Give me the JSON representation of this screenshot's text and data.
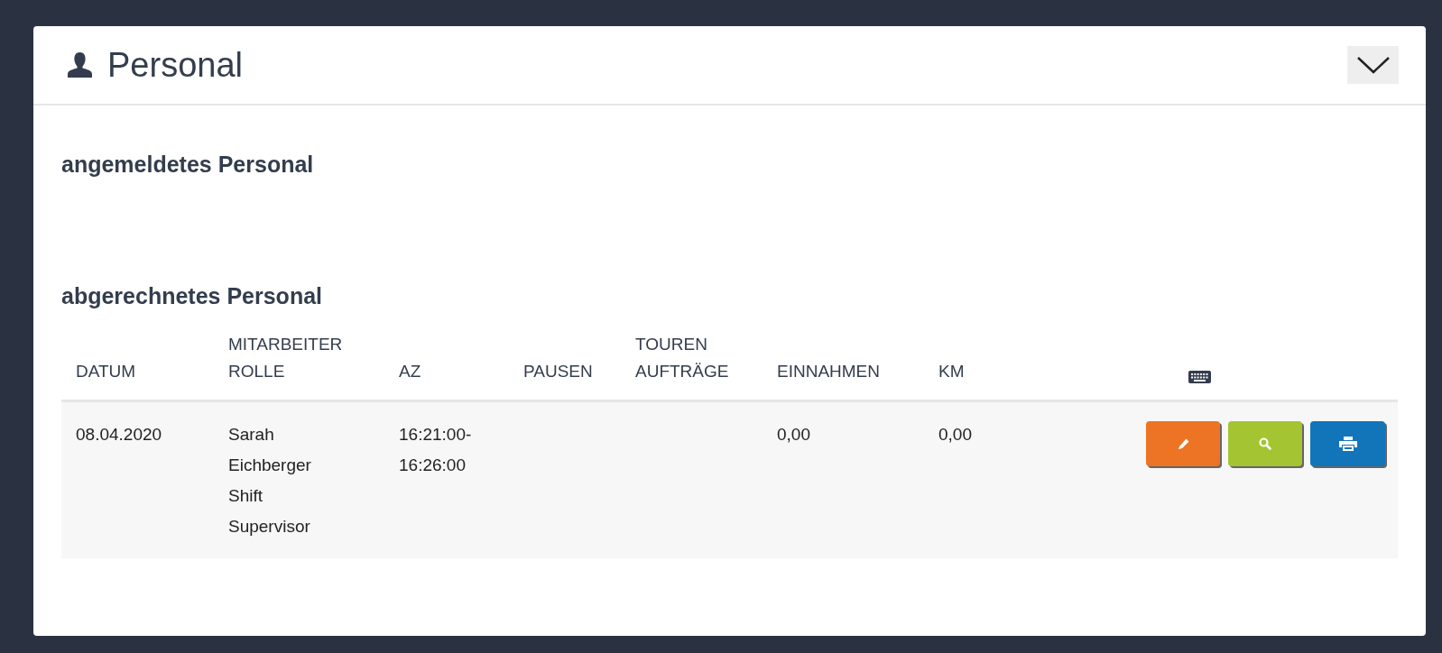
{
  "panel": {
    "title": "Personal",
    "expanded": true
  },
  "sections": [
    {
      "heading": "angemeldetes Personal"
    },
    {
      "heading": "abgerechnetes Personal"
    }
  ],
  "table": {
    "columns": [
      {
        "lines": [
          "DATUM"
        ]
      },
      {
        "lines": [
          "MITARBEITER",
          "ROLLE"
        ]
      },
      {
        "lines": [
          "AZ"
        ]
      },
      {
        "lines": [
          "PAUSEN"
        ]
      },
      {
        "lines": [
          "TOUREN",
          "AUFTRÄGE"
        ]
      },
      {
        "lines": [
          "EINNAHMEN"
        ]
      },
      {
        "lines": [
          "KM"
        ]
      },
      {
        "kind": "keyboard"
      }
    ],
    "rows": [
      {
        "datum": "08.04.2020",
        "mitarbeiter": "Sarah Eichberger",
        "rolle": "Shift Supervisor",
        "az": "16:21:00-16:26:00",
        "pausen": "",
        "touren": "",
        "einnahmen": "0,00",
        "km": "0,00",
        "actions": [
          {
            "kind": "edit",
            "color": "#ec7424"
          },
          {
            "kind": "view",
            "color": "#a4c431"
          },
          {
            "kind": "print",
            "color": "#1275ba"
          }
        ]
      }
    ]
  }
}
